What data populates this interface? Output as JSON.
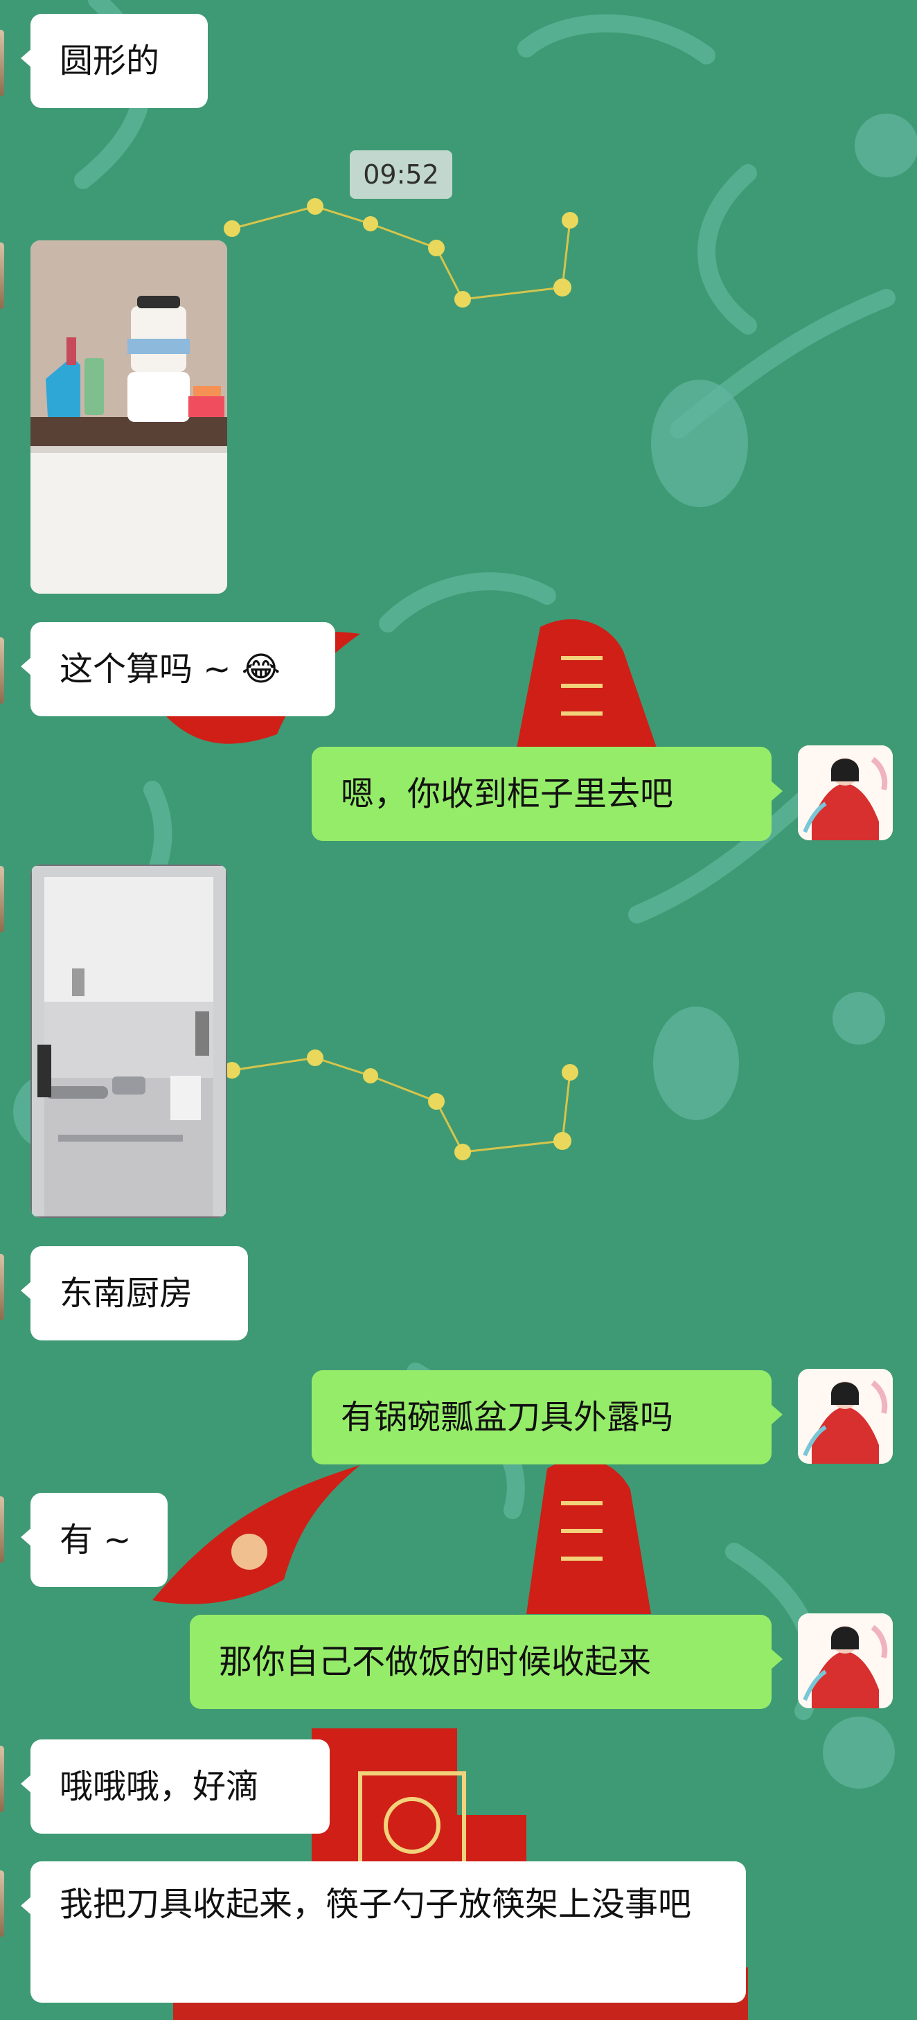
{
  "chat": {
    "timestamp": "09:52",
    "messages": [
      {
        "side": "left",
        "type": "text",
        "text": "圆形的"
      },
      {
        "side": "left",
        "type": "image",
        "image": "shelf-with-bottles-photo"
      },
      {
        "side": "left",
        "type": "text",
        "text": "这个算吗 ~ 😂"
      },
      {
        "side": "right",
        "type": "text",
        "text": "嗯，你收到柜子里去吧"
      },
      {
        "side": "left",
        "type": "image",
        "image": "kitchen-photo"
      },
      {
        "side": "left",
        "type": "text",
        "text": "东南厨房"
      },
      {
        "side": "right",
        "type": "text",
        "text": "有锅碗瓢盆刀具外露吗"
      },
      {
        "side": "left",
        "type": "text",
        "text": "有 ~"
      },
      {
        "side": "right",
        "type": "text",
        "text": "那你自己不做饭的时候收起来"
      },
      {
        "side": "left",
        "type": "text",
        "text": "哦哦哦，好滴"
      },
      {
        "side": "left",
        "type": "text",
        "text": "我把刀具收起来，筷子勺子放筷架上没事吧"
      }
    ]
  },
  "colors": {
    "wallpaper": "#3e9a74",
    "incoming_bubble": "#ffffff",
    "outgoing_bubble": "#95ec69",
    "timestamp_bg": "#cddcd5",
    "decorative_red": "#cf1f17"
  },
  "icons": {
    "sender_avatar": "woman-in-red-hanfu-avatar",
    "contact_avatar_edge": "contact-avatar-edge"
  }
}
